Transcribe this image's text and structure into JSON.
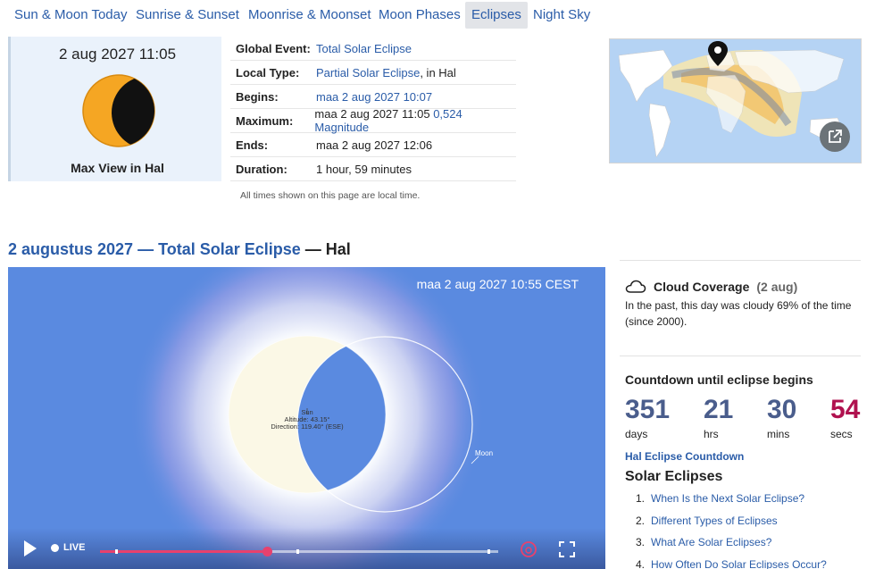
{
  "nav": {
    "items": [
      "Sun & Moon Today",
      "Sunrise & Sunset",
      "Moonrise & Moonset",
      "Moon Phases",
      "Eclipses",
      "Night Sky"
    ],
    "active": "Eclipses"
  },
  "summary": {
    "datetime": "2 aug 2027 11:05",
    "caption": "Max View in Hal"
  },
  "info": {
    "rows": [
      {
        "key": "Global Event:",
        "link": "Total Solar Eclipse",
        "text": ""
      },
      {
        "key": "Local Type:",
        "link": "Partial Solar Eclipse",
        "text": ", in Hal"
      },
      {
        "key": "Begins:",
        "link": "maa 2 aug 2027 10:07",
        "text": ""
      },
      {
        "key": "Maximum:",
        "text": "maa 2 aug 2027 11:05 ",
        "link": "0,524 Magnitude"
      },
      {
        "key": "Ends:",
        "text": "maa 2 aug 2027 12:06",
        "link": ""
      },
      {
        "key": "Duration:",
        "text": "1 hour, 59 minutes",
        "link": ""
      }
    ],
    "note": "All times shown on this page are local time."
  },
  "headline": {
    "link": "2 augustus 2027 — Total Solar Eclipse",
    "suffix": " — Hal"
  },
  "animation": {
    "timestamp": "maa 2 aug 2027 10:55 CEST",
    "sun_label": "Sun",
    "altitude": "Altitude: 43.15°",
    "direction": "Direction: 119.40° (ESE)",
    "moon_label": "Moon",
    "live_label": "LIVE",
    "progress": 0.42
  },
  "cloud": {
    "title": "Cloud Coverage",
    "date": "(2 aug)",
    "text": "In the past, this day was cloudy 69% of the time (since 2000)."
  },
  "countdown": {
    "title": "Countdown until eclipse begins",
    "days": "351",
    "days_label": "days",
    "hrs": "21",
    "hrs_label": "hrs",
    "mins": "30",
    "mins_label": "mins",
    "secs": "54",
    "secs_label": "secs",
    "link": "Hal Eclipse Countdown"
  },
  "solar_eclipses": {
    "title": "Solar Eclipses",
    "items": [
      {
        "num": "1.",
        "label": "When Is the Next Solar Eclipse?"
      },
      {
        "num": "2.",
        "label": "Different Types of Eclipses"
      },
      {
        "num": "3.",
        "label": "What Are Solar Eclipses?"
      },
      {
        "num": "4.",
        "label": "How Often Do Solar Eclipses Occur?"
      }
    ]
  },
  "colors": {
    "link": "#2a5ca8",
    "sky": "#5a8ae0",
    "sun_orange": "#f5a623",
    "progress": "#e8416d",
    "secs": "#b0124f"
  }
}
